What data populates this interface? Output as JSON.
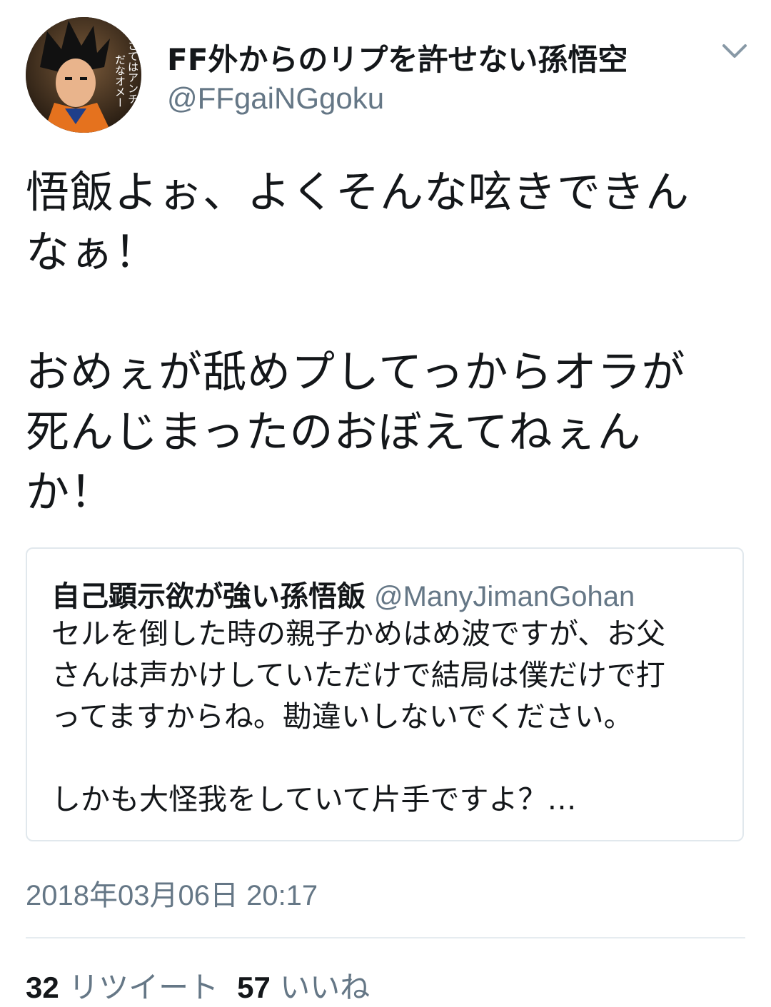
{
  "tweet": {
    "author": {
      "display_name": "FF外からのリプを許せない孫悟空",
      "handle": "@FFgaiNGgoku",
      "avatar_icon": "avatar-goku",
      "avatar_caption_line1": "さてはアンチ",
      "avatar_caption_line2": "だなオメー"
    },
    "menu_icon": "chevron-down-icon",
    "text": "悟飯よぉ、よくそんな呟きできん\nなぁ！\n\nおめぇが舐めプしてっからオラが\n死んじまったのおぼえてねぇん\nか！",
    "quoted_tweet": {
      "display_name": "自己顕示欲が強い孫悟飯",
      "handle": "@ManyJimanGohan",
      "text": "セルを倒した時の親子かめはめ波ですが、お父\nさんは声かけしていただけで結局は僕だけで打\nってますからね。勘違いしないでください。\n\nしかも大怪我をしていて片手ですよ？…"
    },
    "timestamp": "2018年03月06日 20:17",
    "stats": {
      "retweets_count": "32",
      "retweets_label": "リツイート",
      "likes_count": "57",
      "likes_label": "いいね"
    }
  },
  "colors": {
    "primary_text": "#14171a",
    "secondary_text": "#657786",
    "border": "#e1e8ed"
  }
}
